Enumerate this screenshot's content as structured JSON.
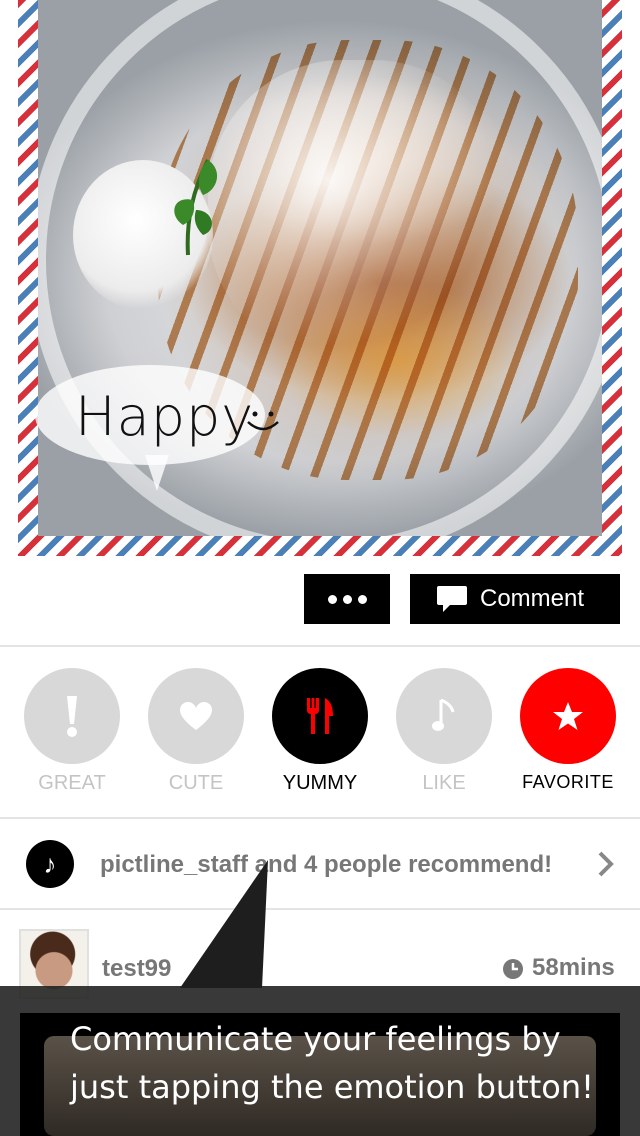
{
  "post": {
    "photo_caption": "Happy",
    "more_label": "more",
    "comment_label": "Comment"
  },
  "emotions": [
    {
      "label": "GREAT",
      "icon": "exclamation-icon",
      "state": "inactive"
    },
    {
      "label": "CUTE",
      "icon": "heart-icon",
      "state": "inactive"
    },
    {
      "label": "YUMMY",
      "icon": "fork-knife-icon",
      "state": "active"
    },
    {
      "label": "LIKE",
      "icon": "music-note-icon",
      "state": "inactive"
    },
    {
      "label": "FAVORITE",
      "icon": "star-icon",
      "state": "active"
    }
  ],
  "recommend": {
    "text": "pictline_staff and 4 people recommend!"
  },
  "comment_user": {
    "username": "test99",
    "time": "58mins"
  },
  "tutorial": {
    "message": "Communicate your feelings by just tapping the emotion button!"
  },
  "colors": {
    "accent_red": "#ff0000",
    "inactive_gray": "#d8d8d8",
    "black": "#000000"
  }
}
